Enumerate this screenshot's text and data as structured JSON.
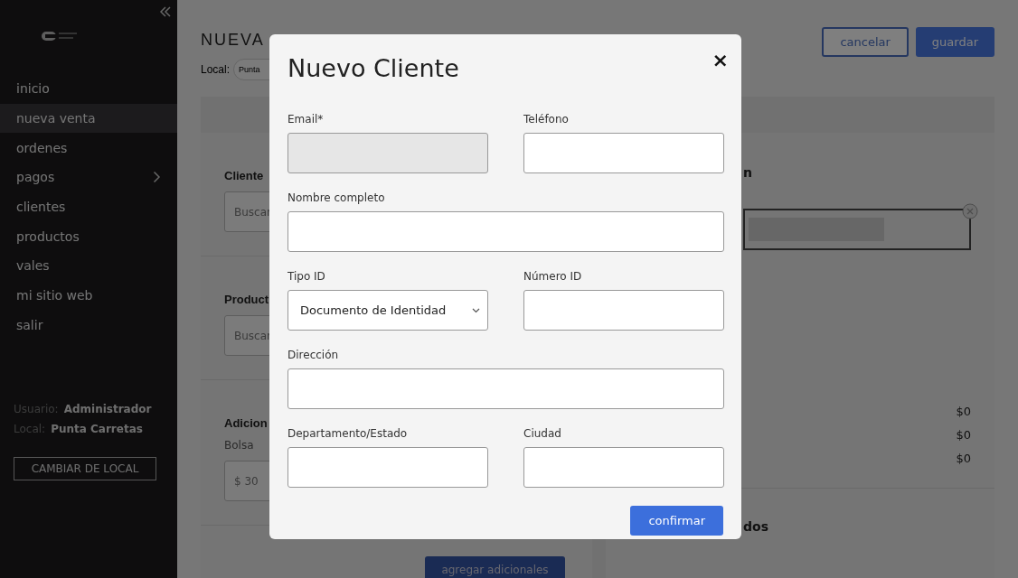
{
  "sidebar": {
    "items": [
      {
        "label": "inicio",
        "selected": false,
        "submenu": false
      },
      {
        "label": "nueva venta",
        "selected": true,
        "submenu": false
      },
      {
        "label": "ordenes",
        "selected": false,
        "submenu": false
      },
      {
        "label": "pagos",
        "selected": false,
        "submenu": true
      },
      {
        "label": "clientes",
        "selected": false,
        "submenu": false
      },
      {
        "label": "productos",
        "selected": false,
        "submenu": false
      },
      {
        "label": "vales",
        "selected": false,
        "submenu": false
      },
      {
        "label": "mi sitio web",
        "selected": false,
        "submenu": false
      },
      {
        "label": "salir",
        "selected": false,
        "submenu": false
      }
    ],
    "user_label": "Usuario:",
    "user_value": "Administrador",
    "local_label": "Local:",
    "local_value": "Punta Carretas",
    "change_button": "CAMBIAR DE LOCAL"
  },
  "page": {
    "title": "NUEVA",
    "local_label": "Local:",
    "local_value": "Punta",
    "buttons": [
      {
        "label": "cancelar",
        "kind": "outline"
      },
      {
        "label": "guardar",
        "kind": "primary"
      }
    ]
  },
  "left_card": {
    "sections": [
      {
        "heading": "Cliente",
        "field_value": "Buscar"
      },
      {
        "heading": "Product",
        "field_value": "Buscar"
      },
      {
        "heading": "Adicion",
        "field_label": "Bolsa",
        "field_value": "$ 30"
      }
    ],
    "button": "agregar adicionales"
  },
  "right_card": {
    "heading": "n",
    "totals": [
      "$0",
      "$0",
      "$0"
    ],
    "footer_heading": "dos"
  },
  "modal": {
    "title": "Nuevo Cliente",
    "close": "×",
    "fields": [
      {
        "label": "Email*",
        "kind": "text",
        "wide": false,
        "hovered": true
      },
      {
        "label": "Teléfono",
        "kind": "text",
        "wide": false,
        "hovered": false
      },
      {
        "label": "Nombre completo",
        "kind": "text",
        "wide": true,
        "hovered": false
      },
      {
        "label": "Tipo ID",
        "kind": "select",
        "value": "Documento de Identidad",
        "wide": false,
        "hovered": false
      },
      {
        "label": "Número ID",
        "kind": "text",
        "wide": false,
        "hovered": false
      },
      {
        "label": "Dirección",
        "kind": "text",
        "wide": true,
        "hovered": false
      },
      {
        "label": "Departamento/Estado",
        "kind": "text",
        "wide": false,
        "hovered": false
      },
      {
        "label": "Ciudad",
        "kind": "text",
        "wide": false,
        "hovered": false
      }
    ],
    "confirm": "confirmar"
  }
}
